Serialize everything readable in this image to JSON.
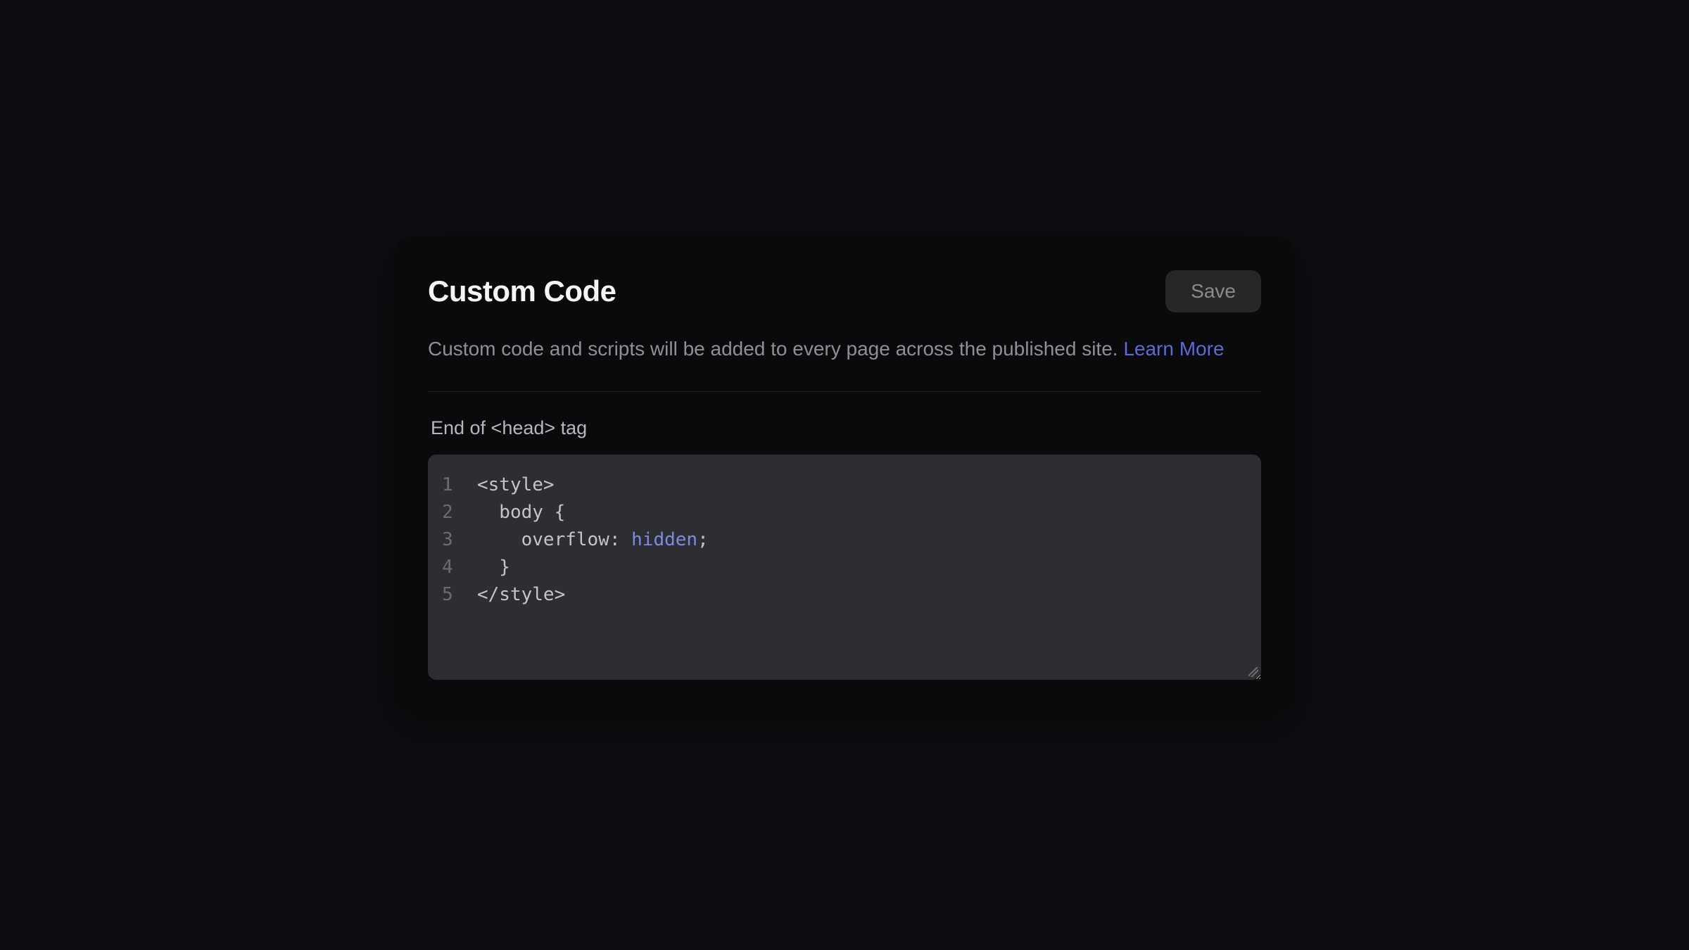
{
  "card": {
    "title": "Custom Code",
    "save_label": "Save",
    "description_text": "Custom code and scripts will be added to every page across the published site. ",
    "learn_more_label": "Learn More"
  },
  "section": {
    "label": "End of <head> tag"
  },
  "code": {
    "lines": [
      {
        "num": "1",
        "content": "<style>"
      },
      {
        "num": "2",
        "content": "  body {"
      },
      {
        "num": "3",
        "prefix": "    overflow: ",
        "keyword": "hidden",
        "suffix": ";"
      },
      {
        "num": "4",
        "content": "  }"
      },
      {
        "num": "5",
        "content": "</style>"
      }
    ]
  }
}
